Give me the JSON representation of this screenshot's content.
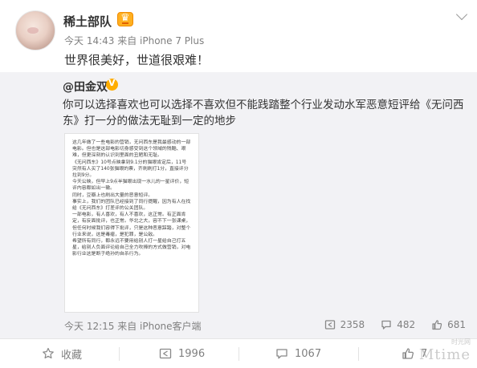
{
  "post": {
    "author": "稀土部队",
    "meta": "今天 14:43 来自 iPhone 7 Plus",
    "text": "世界很美好，世道很艰难！"
  },
  "repost": {
    "author": "@田金双",
    "text": "你可以选择喜欢也可以选择不喜欢但不能践踏整个行业发动水军恶意短评给《无问西东》打一分的做法无耻到一定的地步",
    "image_text": [
      "这几年做了一些电影的营销，无问西东是我最感动的一部电影。但也是这部电影切身感受到这个领域的残酷、艰难，但更深刻的认识到里面的丑陋和无耻。",
      "《无问西东》10号点映拿到9.1分的猫眼肯定后，11号突然有人买了140张猫眼的票，齐刷刷打1分，直接评分拉到9分。",
      "今天公映，但早上9点半猫眼出现一水儿的一星评价，短评内容都如出一辙。",
      "同时，豆瓣上也刷出大量的恶意短评。",
      "事实上，我们的团队已经接到了同行提醒，因为有人在找给《无问西东》打差评的公关团队。",
      "一部电影，有人喜欢，有人不喜欢，这正常。有正面肯定，有反面批评，也正常。华北之大，容不下一张课桌，但任何时候我们容得下批评，只是这种恶意踩踏，对整个行业来说，这是毒瘤，是犯罪，是公敌。",
      "希望所有同行，都永远不要用给别人打一星给自己打五星，给别人负面评论给自己全力吹捧的方式做营销，对电影行业这是断子绝孙的自杀行为。"
    ],
    "meta": "今天 12:15 来自 iPhone客户端",
    "repost_count": "2358",
    "comment_count": "482",
    "like_count": "681"
  },
  "actions": {
    "favorite": "收藏",
    "repost": "1996",
    "comment": "1067",
    "like": "7"
  },
  "watermark": {
    "brand": "Mtime",
    "sub": "时光网"
  }
}
